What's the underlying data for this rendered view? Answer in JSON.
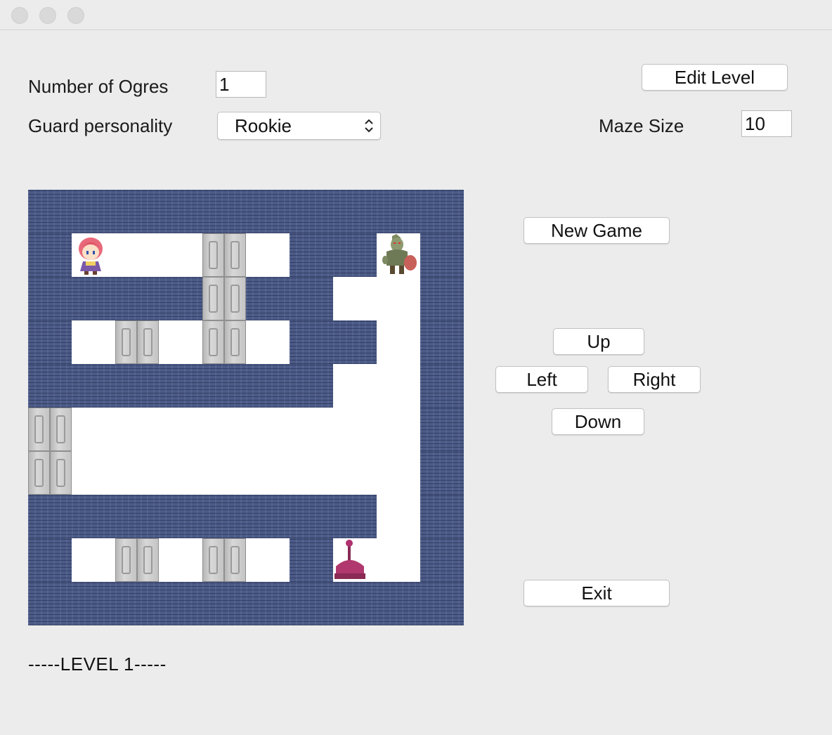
{
  "controls": {
    "ogres_label": "Number of Ogres",
    "ogres_value": "1",
    "guard_label": "Guard personality",
    "guard_value": "Rookie",
    "maze_size_label": "Maze Size",
    "maze_size_value": "10"
  },
  "buttons": {
    "edit_level": "Edit Level",
    "new_game": "New Game",
    "up": "Up",
    "left": "Left",
    "right": "Right",
    "down": "Down",
    "exit": "Exit"
  },
  "maze": {
    "legend": {
      "X": "wall",
      " ": "floor",
      "I": "door",
      "H": "hero",
      "O": "ogre",
      "K": "lever"
    },
    "rows": [
      "XXXXXXXXXX",
      "XH  I XXOX",
      "XXXXIXX  X",
      "X I I XX X",
      "XXXXXXX  X",
      "I        X",
      "I        X",
      "XXXXXXXX X",
      "X I I XK X",
      "XXXXXXXXXX"
    ]
  },
  "status": {
    "level_text": "-----LEVEL 1-----"
  },
  "colors": {
    "wall": "#4b5a86",
    "floor": "#ffffff",
    "window_bg": "#ececec"
  }
}
